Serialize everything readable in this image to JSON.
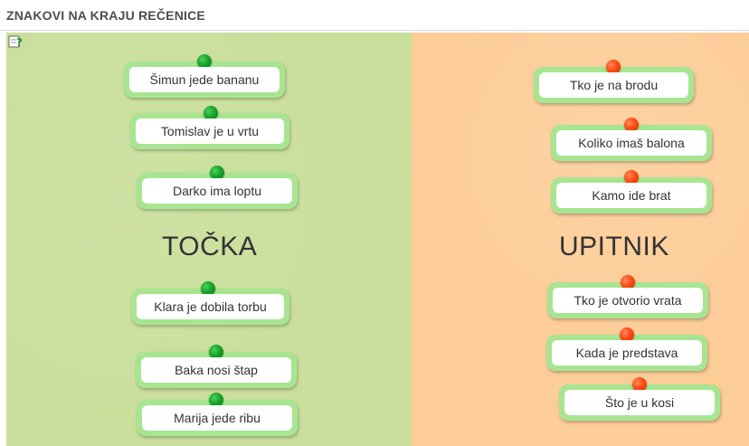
{
  "header": {
    "title": "ZNAKOVI NA KRAJU REČENICE"
  },
  "zones": {
    "left": {
      "label": "TOČKA",
      "color": "#cadf9c"
    },
    "right": {
      "label": "UPITNIK",
      "color": "#fdcd98"
    }
  },
  "help": {
    "icon": "help-question-icon"
  },
  "cards_left": [
    "Šimun jede bananu",
    "Tomislav je u vrtu",
    "Darko ima loptu",
    "Klara je dobila torbu",
    "Baka nosi štap",
    "Marija jede ribu"
  ],
  "cards_right": [
    "Tko je na brodu",
    "Koliko imaš balona",
    "Kamo ide brat",
    "Tko je otvorio vrata",
    "Kada je predstava",
    "Što je u kosi"
  ],
  "colors": {
    "card_border": "#a8e592",
    "pin_green": "#18a42a",
    "pin_red": "#ff4b14"
  }
}
